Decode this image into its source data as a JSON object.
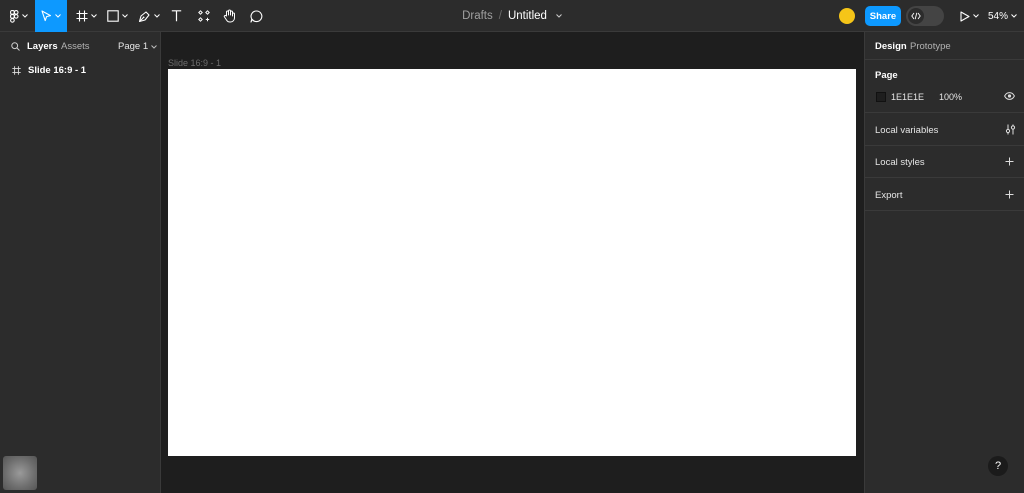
{
  "toolbar": {
    "breadcrumb_parent": "Drafts",
    "breadcrumb_separator": "/",
    "file_name": "Untitled",
    "share_label": "Share",
    "zoom_label": "54%",
    "accent_color": "#0d99ff",
    "avatar_color": "#f5c518"
  },
  "left_panel": {
    "tabs": [
      "Layers",
      "Assets"
    ],
    "page_select": "Page 1",
    "layers": [
      {
        "label": "Slide 16:9 - 1",
        "icon": "frame-icon"
      }
    ]
  },
  "canvas": {
    "frame_label": "Slide 16:9 - 1",
    "canvas_color": "#1e1e1e",
    "frame_color": "#ffffff"
  },
  "right_panel": {
    "tabs": [
      "Design",
      "Prototype"
    ],
    "page_section": {
      "title": "Page",
      "hex": "1E1E1E",
      "opacity": "100%"
    },
    "sections": [
      {
        "label": "Local variables",
        "icon": "variables-adjust-icon"
      },
      {
        "label": "Local styles",
        "icon": "plus-icon"
      },
      {
        "label": "Export",
        "icon": "plus-icon"
      }
    ]
  },
  "help_label": "?"
}
